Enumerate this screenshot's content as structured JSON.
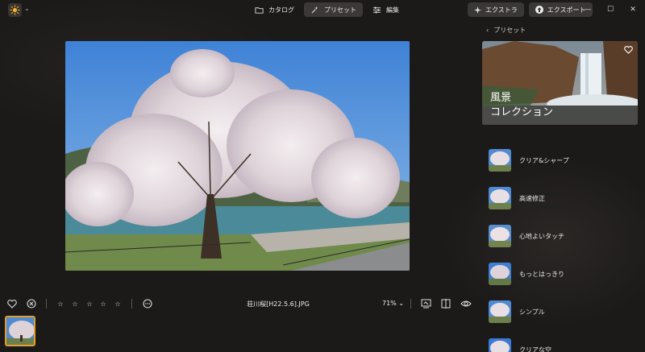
{
  "colors": {
    "accent": "#e0a030",
    "panel": "#3a3736"
  },
  "topnav": {
    "catalog": "カタログ",
    "preset": "プリセット",
    "edit": "編集"
  },
  "actions": {
    "extra": "エクストラ",
    "export": "エクスポート"
  },
  "window": {
    "minimize": "—",
    "maximize": "☐",
    "close": "✕"
  },
  "bottombar": {
    "filename": "荘川桜[H22.5.6].JPG",
    "zoom": "71%"
  },
  "panel": {
    "back_label": "プリセット",
    "banner_title": "風景\nコレクション",
    "presets": [
      {
        "label": "クリア&シャープ"
      },
      {
        "label": "高速修正"
      },
      {
        "label": "心地よいタッチ"
      },
      {
        "label": "もっとはっきり"
      },
      {
        "label": "シンプル"
      },
      {
        "label": "クリアな空"
      }
    ]
  }
}
